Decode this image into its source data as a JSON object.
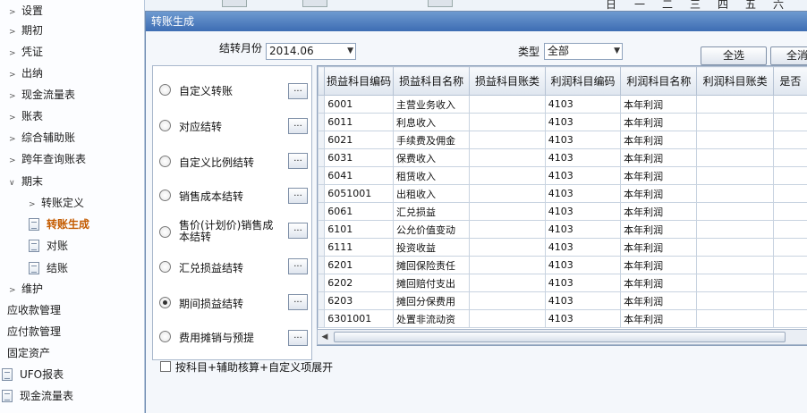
{
  "sidebar": {
    "items": [
      {
        "label": "设置",
        "type": "group"
      },
      {
        "label": "期初",
        "type": "group"
      },
      {
        "label": "凭证",
        "type": "group"
      },
      {
        "label": "出纳",
        "type": "group"
      },
      {
        "label": "现金流量表",
        "type": "group"
      },
      {
        "label": "账表",
        "type": "group"
      },
      {
        "label": "综合辅助账",
        "type": "group"
      },
      {
        "label": "跨年查询账表",
        "type": "group"
      },
      {
        "label": "期末",
        "type": "group-open"
      },
      {
        "label": "转账定义",
        "type": "sub-group"
      },
      {
        "label": "转账生成",
        "type": "leaf-active"
      },
      {
        "label": "对账",
        "type": "leaf"
      },
      {
        "label": "结账",
        "type": "leaf"
      },
      {
        "label": "维护",
        "type": "group"
      },
      {
        "label": "应收款管理",
        "type": "root"
      },
      {
        "label": "应付款管理",
        "type": "root"
      },
      {
        "label": "固定资产",
        "type": "root"
      },
      {
        "label": "UFO报表",
        "type": "root-icon"
      },
      {
        "label": "现金流量表",
        "type": "root-icon"
      }
    ]
  },
  "calendar_header": {
    "days": [
      "日",
      "一",
      "二",
      "三",
      "四",
      "五",
      "六"
    ]
  },
  "dialog": {
    "title": "转账生成",
    "month_label": "结转月份",
    "month_value": "2014.06",
    "type_label": "类型",
    "type_value": "全部",
    "select_all_button": "全选",
    "cancel_all_button": "全消"
  },
  "transfer_options": [
    {
      "label": "自定义转账",
      "checked": false
    },
    {
      "label": "对应结转",
      "checked": false
    },
    {
      "label": "自定义比例结转",
      "checked": false
    },
    {
      "label": "销售成本结转",
      "checked": false
    },
    {
      "label": "售价(计划价)销售成本结转",
      "checked": false
    },
    {
      "label": "汇兑损益结转",
      "checked": false
    },
    {
      "label": "期间损益结转",
      "checked": true
    },
    {
      "label": "费用摊销与预提",
      "checked": false
    }
  ],
  "ellipsis_label": "...",
  "grid": {
    "columns": [
      "损益科目编码",
      "损益科目名称",
      "损益科目账类",
      "利润科目编码",
      "利润科目名称",
      "利润科目账类",
      "是否"
    ],
    "rows": [
      [
        "6001",
        "主营业务收入",
        "",
        "4103",
        "本年利润",
        "",
        ""
      ],
      [
        "6011",
        "利息收入",
        "",
        "4103",
        "本年利润",
        "",
        ""
      ],
      [
        "6021",
        "手续费及佣金",
        "",
        "4103",
        "本年利润",
        "",
        ""
      ],
      [
        "6031",
        "保费收入",
        "",
        "4103",
        "本年利润",
        "",
        ""
      ],
      [
        "6041",
        "租赁收入",
        "",
        "4103",
        "本年利润",
        "",
        ""
      ],
      [
        "6051001",
        "出租收入",
        "",
        "4103",
        "本年利润",
        "",
        ""
      ],
      [
        "6061",
        "汇兑损益",
        "",
        "4103",
        "本年利润",
        "",
        ""
      ],
      [
        "6101",
        "公允价值变动",
        "",
        "4103",
        "本年利润",
        "",
        ""
      ],
      [
        "6111",
        "投资收益",
        "",
        "4103",
        "本年利润",
        "",
        ""
      ],
      [
        "6201",
        "摊回保险责任",
        "",
        "4103",
        "本年利润",
        "",
        ""
      ],
      [
        "6202",
        "摊回赔付支出",
        "",
        "4103",
        "本年利润",
        "",
        ""
      ],
      [
        "6203",
        "摊回分保费用",
        "",
        "4103",
        "本年利润",
        "",
        ""
      ],
      [
        "6301001",
        "处置非流动资",
        "",
        "4103",
        "本年利润",
        "",
        ""
      ]
    ]
  },
  "expand_checkbox_label": "按科目+辅助核算+自定义项展开",
  "expand_checked": false
}
